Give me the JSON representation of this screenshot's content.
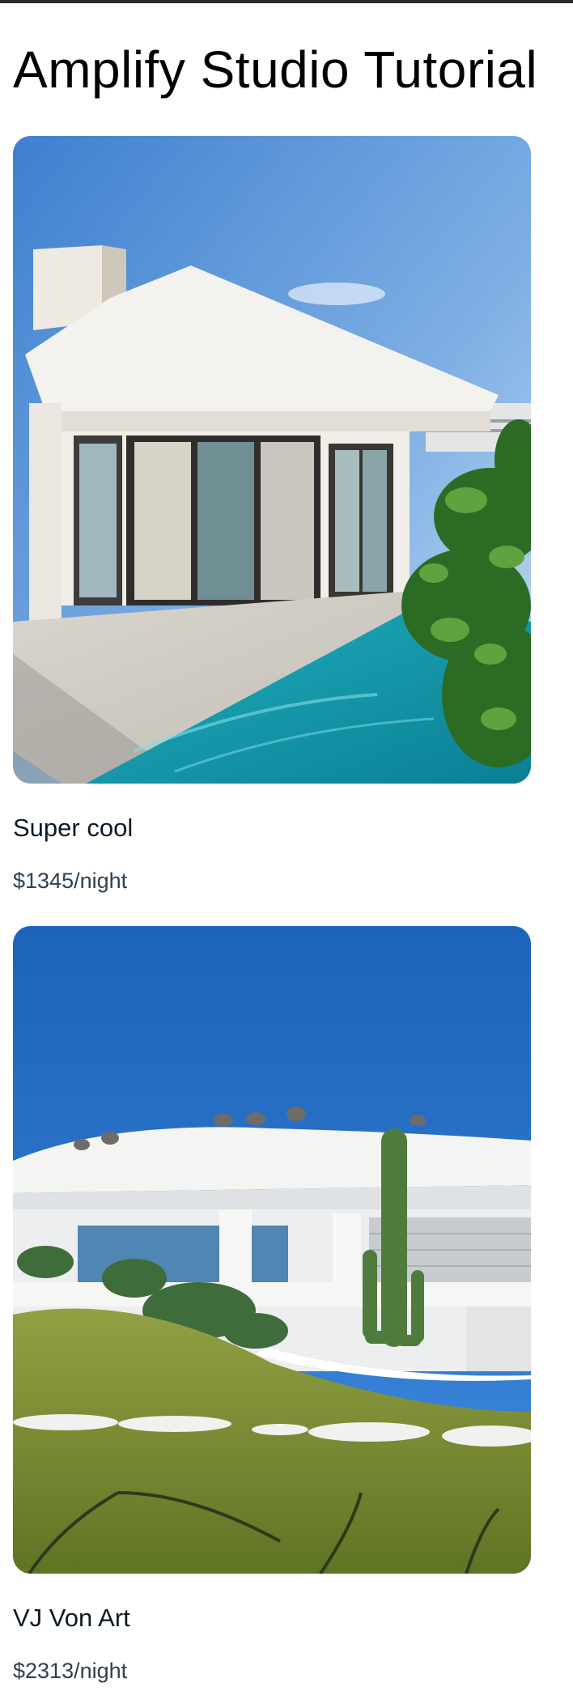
{
  "page": {
    "title": "Amplify Studio Tutorial"
  },
  "listings": [
    {
      "name": "Super cool",
      "price": "$1345/night",
      "image_alt": "Super cool"
    },
    {
      "name": "VJ Von Art",
      "price": "$2313/night",
      "image_alt": "VJ Von Art"
    }
  ],
  "colors": {
    "text_primary": "#0d1a26",
    "text_secondary": "#304050",
    "top_border": "#2b2b2b"
  }
}
